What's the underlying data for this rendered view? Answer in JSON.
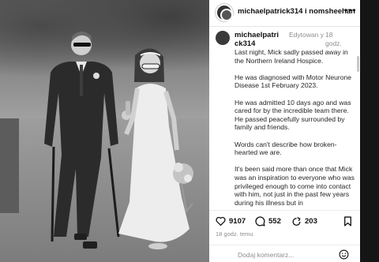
{
  "post": {
    "header_usernames": "michaelpatrick314 i nomsheehan",
    "more_icon": "more-horizontal-icon"
  },
  "caption": {
    "username": "michaelpatrick314",
    "edited": "Edytowan y",
    "time": "18 godz.",
    "paragraphs": [
      "Last night, Mick sadly passed away in the Northern Ireland Hospice.",
      "He was diagnosed with Motor Neurone Disease 1st February 2023.",
      "He was admitted 10 days ago and was cared for by the incredible team there. He passed peacefully surrounded by family and friends.",
      "Words can't describe how broken-hearted we are.",
      "It's been said more than once that Mick was an inspiration to everyone who was privileged enough to come into contact with him, not just in the past few years during his illness but in"
    ]
  },
  "actions": {
    "likes": "9107",
    "comments": "552",
    "shares": "203",
    "icons": [
      "heart-icon",
      "comment-icon",
      "share-icon",
      "bookmark-icon"
    ]
  },
  "timestamp": "18 godz. temu",
  "comment_bar": {
    "placeholder": "Dodaj komentarz...",
    "emoji_icon": "emoji-icon"
  }
}
